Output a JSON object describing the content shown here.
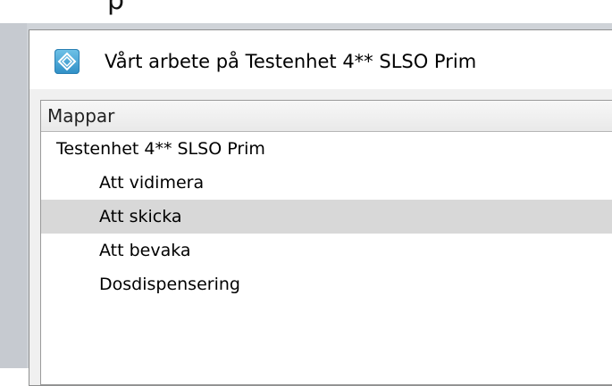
{
  "background_glyph": "p",
  "window": {
    "title": "Vårt arbete på Testenhet 4** SLSO Prim",
    "icon": "app-diamond-icon"
  },
  "folders_panel": {
    "header": "Mappar",
    "root": "Testenhet 4** SLSO Prim",
    "items": [
      {
        "label": "Att vidimera",
        "selected": false
      },
      {
        "label": "Att skicka",
        "selected": true
      },
      {
        "label": "Att bevaka",
        "selected": false
      },
      {
        "label": "Dosdispensering",
        "selected": false
      }
    ]
  },
  "colors": {
    "selected_row": "#d8d8d8",
    "icon_blue": "#2f8fc6"
  }
}
